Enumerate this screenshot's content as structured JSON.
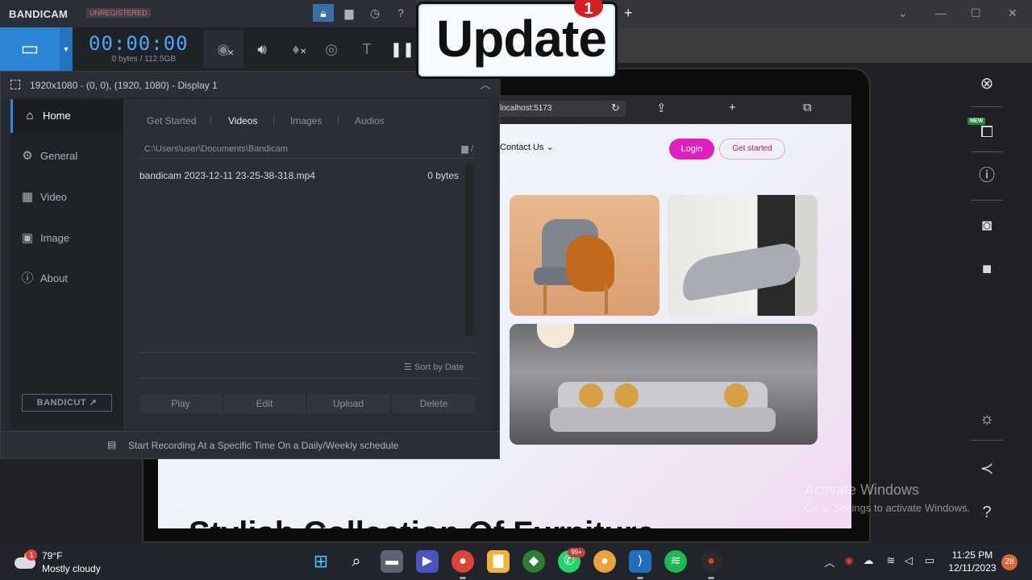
{
  "bandicam": {
    "logo": "BANDICAM",
    "unregistered": "UNREGISTERED",
    "timer": "00:00:00",
    "size": "0 bytes / 112.5GB",
    "region": "1920x1080 - (0, 0), (1920, 1080) - Display 1",
    "nav": [
      {
        "label": "Home",
        "icon": "house-icon"
      },
      {
        "label": "General",
        "icon": "gear-icon"
      },
      {
        "label": "Video",
        "icon": "film-icon"
      },
      {
        "label": "Image",
        "icon": "image-icon"
      },
      {
        "label": "About",
        "icon": "info-icon"
      }
    ],
    "bandicut": "BANDICUT",
    "tabs": [
      "Get Started",
      "Videos",
      "Images",
      "Audios"
    ],
    "active_tab": "Videos",
    "path": "C:\\Users\\user\\Documents\\Bandicam",
    "files": [
      {
        "name": "bandicam 2023-12-11 23-25-38-318.mp4",
        "size": "0 bytes"
      }
    ],
    "sort": "Sort by Date",
    "actions": [
      "Play",
      "Edit",
      "Upload",
      "Delete"
    ],
    "footer": "Start Recording At a Specific Time On a Daily/Weekly schedule",
    "accent": "#2b86d8"
  },
  "overlay": {
    "update_label": "Update",
    "badge_count": "1"
  },
  "site": {
    "url": "localhost:5173",
    "nav_contact": "Contact Us",
    "login": "Login",
    "get_started": "Get started",
    "heading": "Stylish Collection Of Furniture",
    "accent": "#e01fbd"
  },
  "watermark": {
    "line1": "Activate Windows",
    "line2": "Go to Settings to activate Windows."
  },
  "taskbar": {
    "weather_temp": "79°F",
    "weather_cond": "Mostly cloudy",
    "weather_badge": "1",
    "whatsapp_badge": "99+",
    "time": "11:25 PM",
    "date": "12/11/2023",
    "notifications": "28"
  },
  "extension_sidebar": {
    "new_badge": "NEW"
  }
}
